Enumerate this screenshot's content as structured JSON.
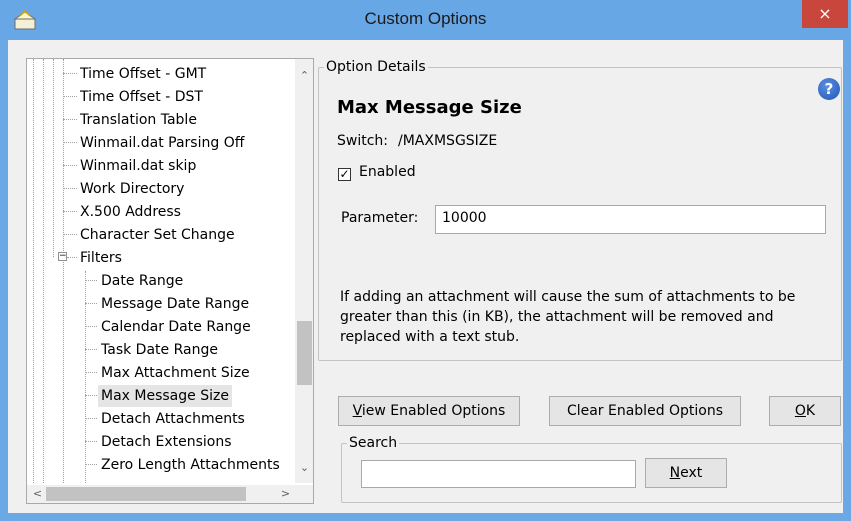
{
  "window": {
    "title": "Custom Options",
    "close_glyph": "×",
    "accent_color": "#68a7e5"
  },
  "tree": {
    "items": [
      "Time Offset - GMT",
      "Time Offset - DST",
      "Translation Table",
      "Winmail.dat Parsing Off",
      "Winmail.dat skip",
      "Work Directory",
      "X.500 Address",
      "Character Set Change",
      "Filters",
      "Date Range",
      "Message Date Range",
      "Calendar Date Range",
      "Task Date Range",
      "Max Attachment Size",
      "Max Message Size",
      "Detach Attachments",
      "Detach Extensions",
      "Zero Length Attachments"
    ],
    "selected": "Max Message Size",
    "expander_glyph": "−",
    "scroll_up": "⌃",
    "scroll_down": "⌄",
    "scroll_left": "<",
    "scroll_right": ">"
  },
  "details": {
    "group_label": "Option Details",
    "title": "Max Message Size",
    "switch_label": "Switch:",
    "switch_value": "/MAXMSGSIZE",
    "enabled_label": "Enabled",
    "enabled_check": "✓",
    "parameter_label": "Parameter:",
    "parameter_value": "10000",
    "help_glyph": "?",
    "description": "If adding an attachment will cause the sum of attachments to be greater than this (in KB), the attachment will be removed and replaced with a text stub."
  },
  "buttons": {
    "view_enabled_v": "V",
    "view_enabled_rest": "iew Enabled Options",
    "clear_enabled": "Clear Enabled Options",
    "ok_o": "O",
    "ok_rest": "K"
  },
  "search": {
    "group_label": "Search",
    "value": "",
    "next_n": "N",
    "next_rest": "ext"
  }
}
